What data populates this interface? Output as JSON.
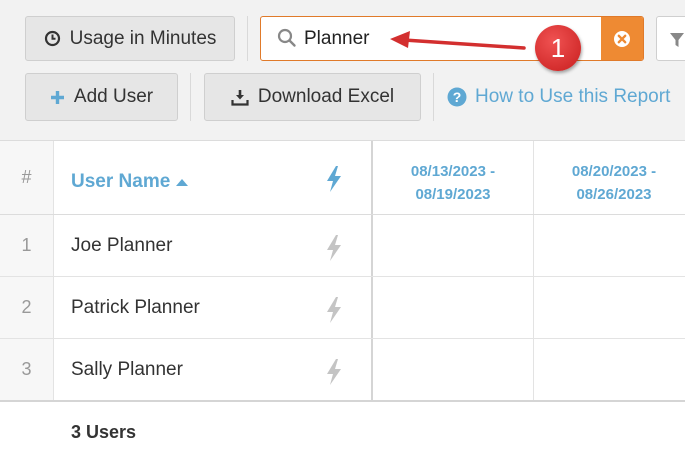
{
  "toolbar": {
    "usage_label": "Usage in Minutes",
    "search_value": "Planner",
    "add_user_label": "Add User",
    "download_label": "Download Excel",
    "help_label": "How to Use this Report"
  },
  "grid": {
    "header": {
      "num": "#",
      "user_name": "User Name",
      "dates": [
        {
          "line1": "08/13/2023 -",
          "line2": "08/19/2023"
        },
        {
          "line1": "08/20/2023 -",
          "line2": "08/26/2023"
        }
      ]
    },
    "rows": [
      {
        "num": "1",
        "name": "Joe Planner"
      },
      {
        "num": "2",
        "name": "Patrick Planner"
      },
      {
        "num": "3",
        "name": "Sally Planner"
      }
    ],
    "footer_total": "3 Users"
  },
  "annotation": {
    "callout_number": "1"
  },
  "colors": {
    "accent_blue": "#5fa8d3",
    "search_border": "#e07a2a",
    "clear_button": "#ee8a33",
    "callout_red": "#d32f2f"
  }
}
